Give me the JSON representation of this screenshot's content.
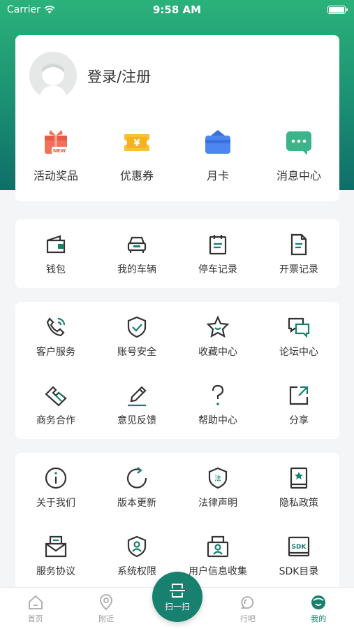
{
  "status_bar": {
    "carrier": "Carrier",
    "time": "9:58 AM"
  },
  "profile": {
    "login_label": "登录/注册"
  },
  "quick_actions": [
    {
      "label": "活动奖品",
      "icon": "gift-icon",
      "badge": "NEW"
    },
    {
      "label": "优惠券",
      "icon": "coupon-icon",
      "symbol": "¥"
    },
    {
      "label": "月卡",
      "icon": "monthly-card-icon"
    },
    {
      "label": "消息中心",
      "icon": "message-icon"
    }
  ],
  "section_1": [
    {
      "label": "钱包",
      "icon": "wallet-icon"
    },
    {
      "label": "我的车辆",
      "icon": "car-icon"
    },
    {
      "label": "停车记录",
      "icon": "parking-record-icon"
    },
    {
      "label": "开票记录",
      "icon": "invoice-icon"
    }
  ],
  "section_2": [
    {
      "label": "客户服务",
      "icon": "phone-icon"
    },
    {
      "label": "账号安全",
      "icon": "shield-check-icon"
    },
    {
      "label": "收藏中心",
      "icon": "star-icon"
    },
    {
      "label": "论坛中心",
      "icon": "forum-icon"
    },
    {
      "label": "商务合作",
      "icon": "handshake-icon"
    },
    {
      "label": "意见反馈",
      "icon": "pen-icon"
    },
    {
      "label": "帮助中心",
      "icon": "question-icon"
    },
    {
      "label": "分享",
      "icon": "share-icon"
    }
  ],
  "section_3": [
    {
      "label": "关于我们",
      "icon": "info-icon"
    },
    {
      "label": "版本更新",
      "icon": "refresh-icon"
    },
    {
      "label": "法律声明",
      "icon": "law-shield-icon",
      "symbol": "法"
    },
    {
      "label": "隐私政策",
      "icon": "privacy-book-icon"
    },
    {
      "label": "服务协议",
      "icon": "agreement-icon"
    },
    {
      "label": "系统权限",
      "icon": "permission-icon"
    },
    {
      "label": "用户信息收集",
      "icon": "user-info-icon"
    },
    {
      "label": "SDK目录",
      "icon": "sdk-icon",
      "symbol": "SDK"
    }
  ],
  "tabbar": {
    "tabs": [
      {
        "label": "首页",
        "icon": "home-icon",
        "active": false
      },
      {
        "label": "附近",
        "icon": "location-pin-icon",
        "active": false
      },
      {
        "label": "行吧",
        "icon": "chat-bubble-icon",
        "active": false
      },
      {
        "label": "我的",
        "icon": "profile-face-icon",
        "active": true
      }
    ],
    "scan_label": "扫一扫"
  },
  "colors": {
    "accent": "#19806c",
    "header_top": "#2bb27a",
    "header_bottom": "#0f6e68",
    "icon_stroke": "#333333"
  }
}
